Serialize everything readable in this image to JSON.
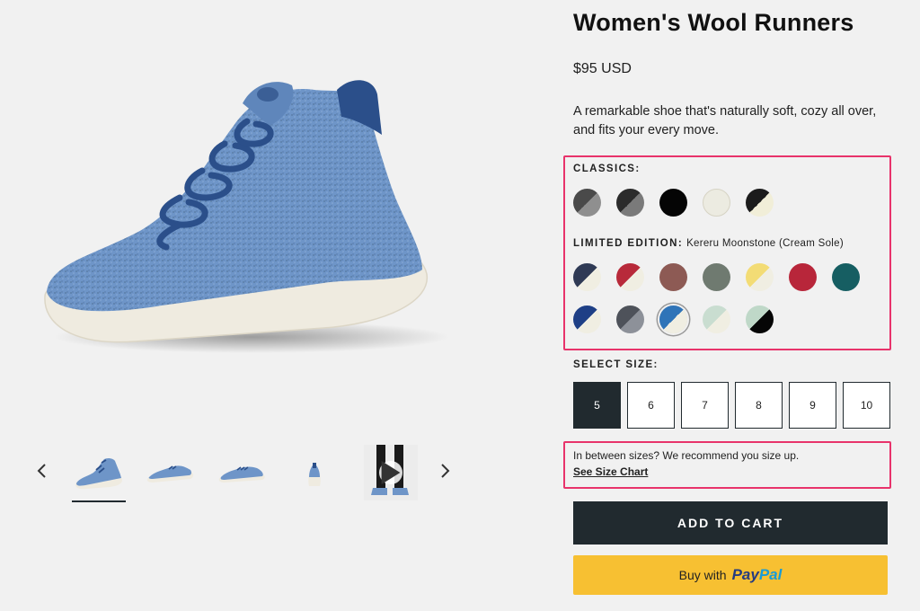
{
  "product": {
    "title": "Women's Wool Runners",
    "price": "$95 USD",
    "description": "A remarkable shoe that's naturally soft, cozy all over, and fits your every move."
  },
  "colors": {
    "classics_label": "CLASSICS:",
    "limited_label": "LIMITED EDITION:",
    "limited_selected_name": "Kereru Moonstone (Cream Sole)",
    "classics": [
      {
        "name": "dark-grey-light-grey",
        "top": "#4a4a4a",
        "bottom": "#8f8f8f"
      },
      {
        "name": "charcoal-grey",
        "top": "#2b2b2b",
        "bottom": "#7a7a7a"
      },
      {
        "name": "black",
        "top": "#050505",
        "bottom": "#050505"
      },
      {
        "name": "cream",
        "top": "#ecebe1",
        "bottom": "#ecebe1"
      },
      {
        "name": "black-cream",
        "top": "#1c1c1c",
        "bottom": "#f1eed8"
      }
    ],
    "limited_row1": [
      {
        "name": "navy-cream",
        "top": "#2f3a55",
        "bottom": "#f0eee2"
      },
      {
        "name": "red-cream",
        "top": "#b82a3a",
        "bottom": "#f0eee2"
      },
      {
        "name": "mauve",
        "top": "#8d5a54",
        "bottom": "#8d5a54"
      },
      {
        "name": "sage",
        "top": "#6f7a70",
        "bottom": "#6f7a70"
      },
      {
        "name": "yellow-cream",
        "top": "#f3dc75",
        "bottom": "#f0eee2"
      },
      {
        "name": "crimson",
        "top": "#b8263a",
        "bottom": "#b8263a"
      },
      {
        "name": "teal",
        "top": "#165e62",
        "bottom": "#165e62"
      }
    ],
    "limited_row2": [
      {
        "name": "royal-blue-cream",
        "top": "#1e3f86",
        "bottom": "#f0eee2"
      },
      {
        "name": "slate-grey",
        "top": "#4e525a",
        "bottom": "#8d9199"
      },
      {
        "name": "kereru-moonstone",
        "top": "#2f74b8",
        "bottom": "#f0eee2",
        "selected": true
      },
      {
        "name": "mint-cream",
        "top": "#c9ddd0",
        "bottom": "#f0eee2"
      },
      {
        "name": "mint-black",
        "top": "#bfd8c8",
        "bottom": "#060606"
      }
    ]
  },
  "sizes": {
    "label": "SELECT SIZE:",
    "options": [
      "5",
      "6",
      "7",
      "8",
      "9",
      "10"
    ],
    "selected": "5"
  },
  "size_hint": {
    "text": "In between sizes? We recommend you size up.",
    "link": "See Size Chart"
  },
  "actions": {
    "add_to_cart": "ADD TO CART",
    "buy_with": "Buy with",
    "paypal_1": "Pay",
    "paypal_2": "Pal"
  },
  "gallery": {
    "thumbnails": [
      "shoe-side-view",
      "shoe-angle-view",
      "shoe-side-view-2",
      "shoe-back-view",
      "video-legs"
    ],
    "active_index": 0,
    "shoe_color": "#6e95c8",
    "sole_color": "#efebe0",
    "lace_color": "#2b4f8a"
  }
}
